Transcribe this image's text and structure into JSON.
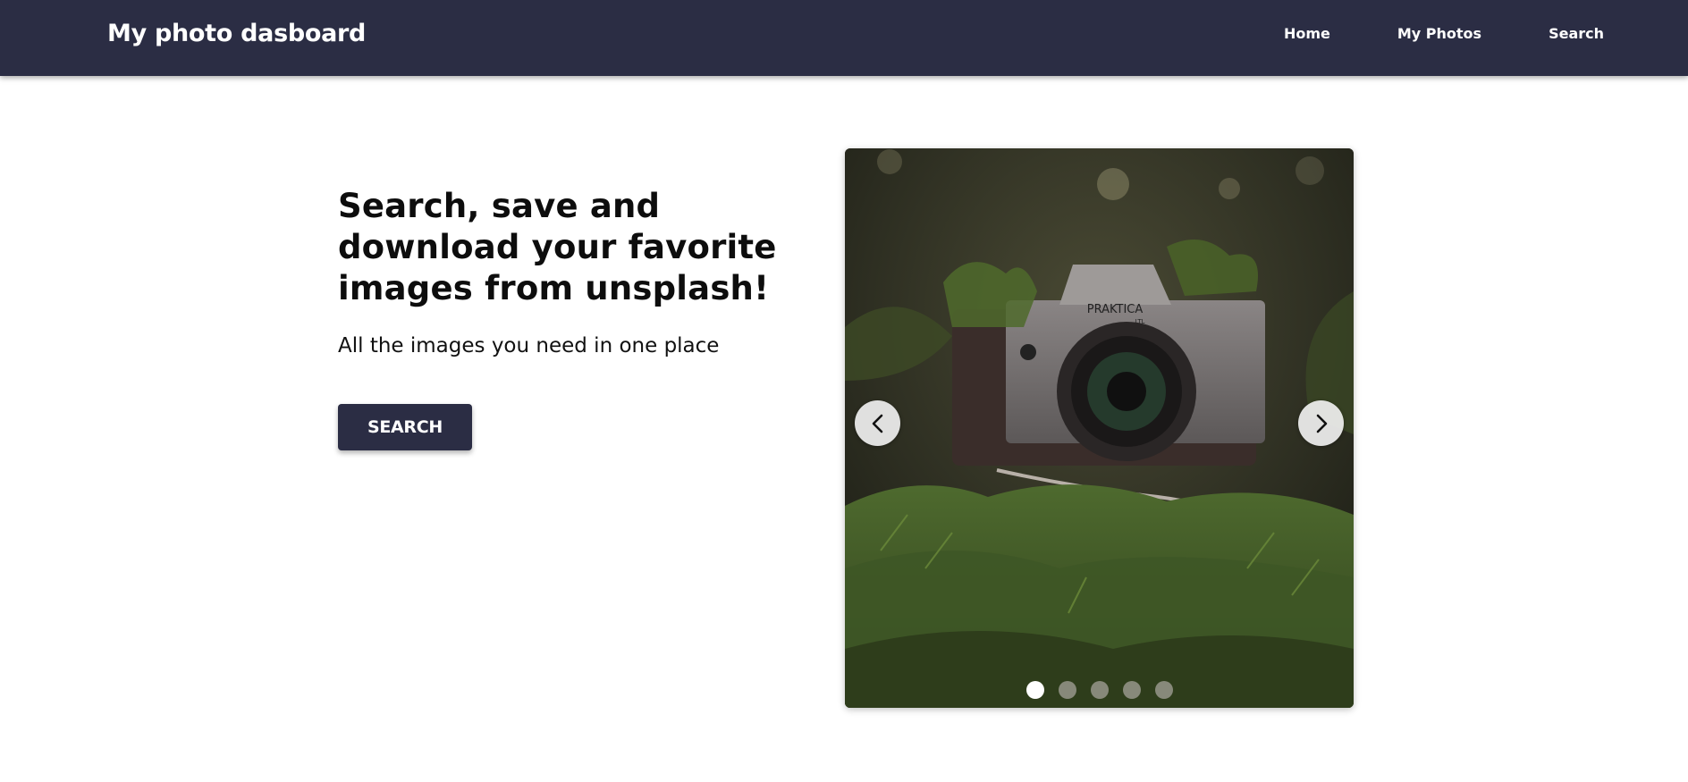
{
  "navbar": {
    "brand": "My photo dasboard",
    "links": [
      {
        "label": "Home"
      },
      {
        "label": "My Photos"
      },
      {
        "label": "Search"
      }
    ],
    "background": "#2b2d44"
  },
  "hero": {
    "title": "Search, save and download your favorite images from unsplash!",
    "subtitle": "All the images you need in one place",
    "button_label": "SEARCH"
  },
  "carousel": {
    "image_label": "PRAKTICA",
    "image_sublabel": "LTL",
    "prev_icon": "chevron-left-icon",
    "next_icon": "chevron-right-icon",
    "slide_count": 5,
    "active_slide": 1
  }
}
